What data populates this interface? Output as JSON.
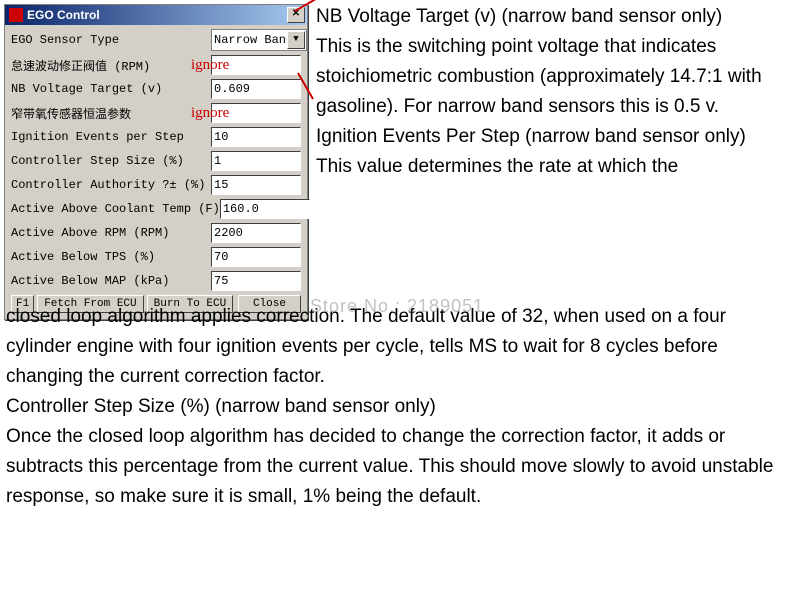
{
  "dialog": {
    "title": "EGO Control",
    "rows": [
      {
        "label": "EGO Sensor Type",
        "type": "select",
        "value": "Narrow Band",
        "ignore": false
      },
      {
        "label": "怠速波动修正阀值 (RPM)",
        "type": "input",
        "value": "",
        "ignore": true
      },
      {
        "label": "NB Voltage Target (v)",
        "type": "input",
        "value": "0.609",
        "ignore": false
      },
      {
        "label": "窄带氧传感器恒温参数",
        "type": "input",
        "value": "",
        "ignore": true
      },
      {
        "label": "Ignition Events per Step",
        "type": "input",
        "value": "10",
        "ignore": false
      },
      {
        "label": "Controller Step Size (%)",
        "type": "input",
        "value": "1",
        "ignore": false
      },
      {
        "label": "Controller Authority ?±  (%)",
        "type": "input",
        "value": "15",
        "ignore": false
      },
      {
        "label": "Active Above Coolant Temp (F)",
        "type": "input",
        "value": "160.0",
        "ignore": false
      },
      {
        "label": "Active Above RPM (RPM)",
        "type": "input",
        "value": "2200",
        "ignore": false
      },
      {
        "label": "Active Below TPS (%)",
        "type": "input",
        "value": "70",
        "ignore": false
      },
      {
        "label": "Active Below MAP (kPa)",
        "type": "input",
        "value": "75",
        "ignore": false
      }
    ],
    "ignore_text": "ignore",
    "buttons": {
      "f1": "F1",
      "fetch": "Fetch From ECU",
      "burn": "Burn To ECU",
      "close": "Close"
    }
  },
  "doc": {
    "top": "NB Voltage Target (v) (narrow band sensor only)\nThis is the switching point voltage that indicates stoichiometric combustion (approximately 14.7:1 with gasoline). For narrow band sensors this is 0.5 v.\nIgnition Events Per Step (narrow band sensor only)\nThis value determines the rate at which the",
    "bottom": "closed loop algorithm applies correction. The default value of 32, when used on a four cylinder engine with four ignition events per cycle, tells MS to wait for 8 cycles before changing the current correction factor.\nController Step Size (%) (narrow band sensor only)\nOnce the closed loop algorithm has decided to change the correction factor, it adds or subtracts this percentage from the current value. This should move slowly to avoid unstable response, so make sure it is small, 1% being the default."
  },
  "watermark": "Store No.: 2189051"
}
